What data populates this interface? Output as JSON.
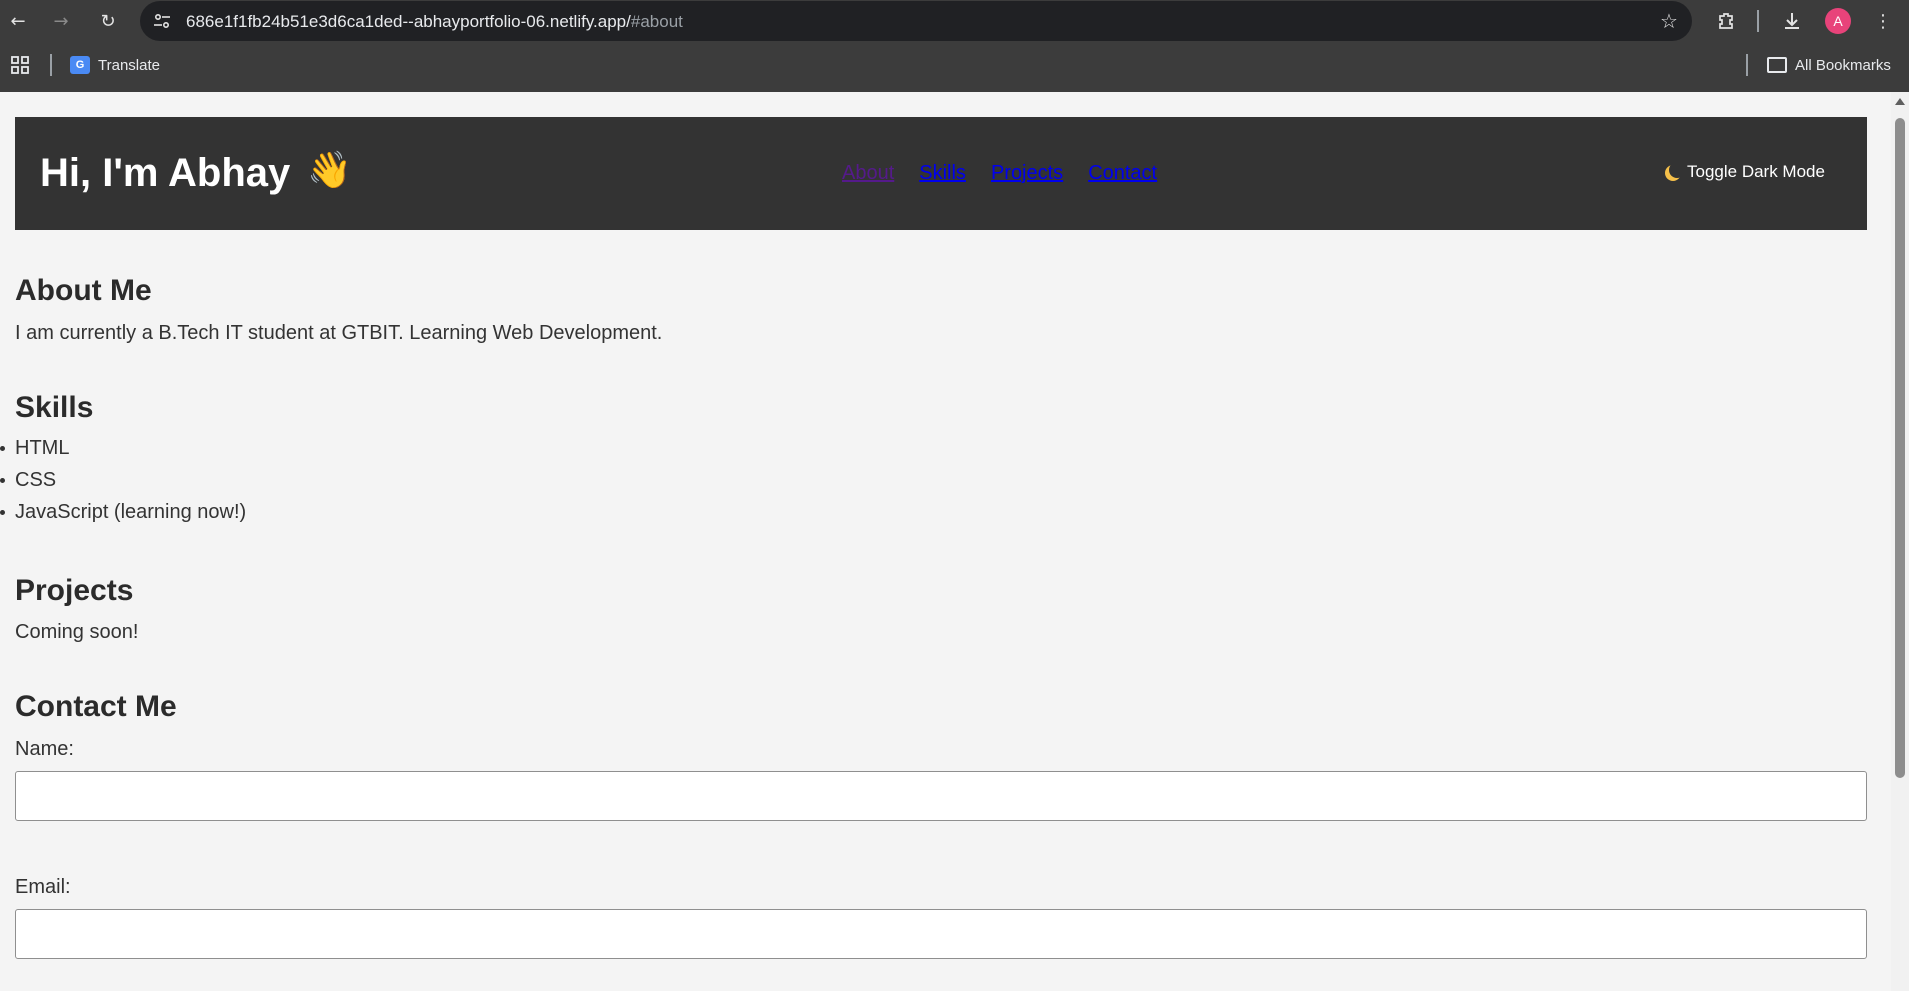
{
  "browser": {
    "url_host": "686e1f1fb24b51e3d6ca1ded--abhayportfolio-06.netlify.app/",
    "url_hash": "#about",
    "avatar_letter": "A",
    "bookmarks": {
      "translate_label": "Translate",
      "all_bookmarks_label": "All Bookmarks"
    }
  },
  "header": {
    "title": "Hi, I'm Abhay",
    "wave_emoji": "👋",
    "nav": [
      {
        "label": "About"
      },
      {
        "label": "Skills"
      },
      {
        "label": "Projects"
      },
      {
        "label": "Contact"
      }
    ],
    "toggle_label": "Toggle Dark Mode"
  },
  "about": {
    "heading": "About Me",
    "text": "I am currently a B.Tech IT student at GTBIT. Learning Web Development."
  },
  "skills": {
    "heading": "Skills",
    "items": [
      "HTML",
      "CSS",
      "JavaScript (learning now!)"
    ]
  },
  "projects": {
    "heading": "Projects",
    "text": "Coming soon!"
  },
  "contact": {
    "heading": "Contact Me",
    "name_label": "Name:",
    "email_label": "Email:",
    "name_value": "",
    "email_value": ""
  },
  "colors": {
    "header_bg": "#333333",
    "page_bg": "#f4f4f4",
    "link": "#0000ee",
    "visited_link": "#551a8b",
    "avatar": "#e8437a"
  }
}
